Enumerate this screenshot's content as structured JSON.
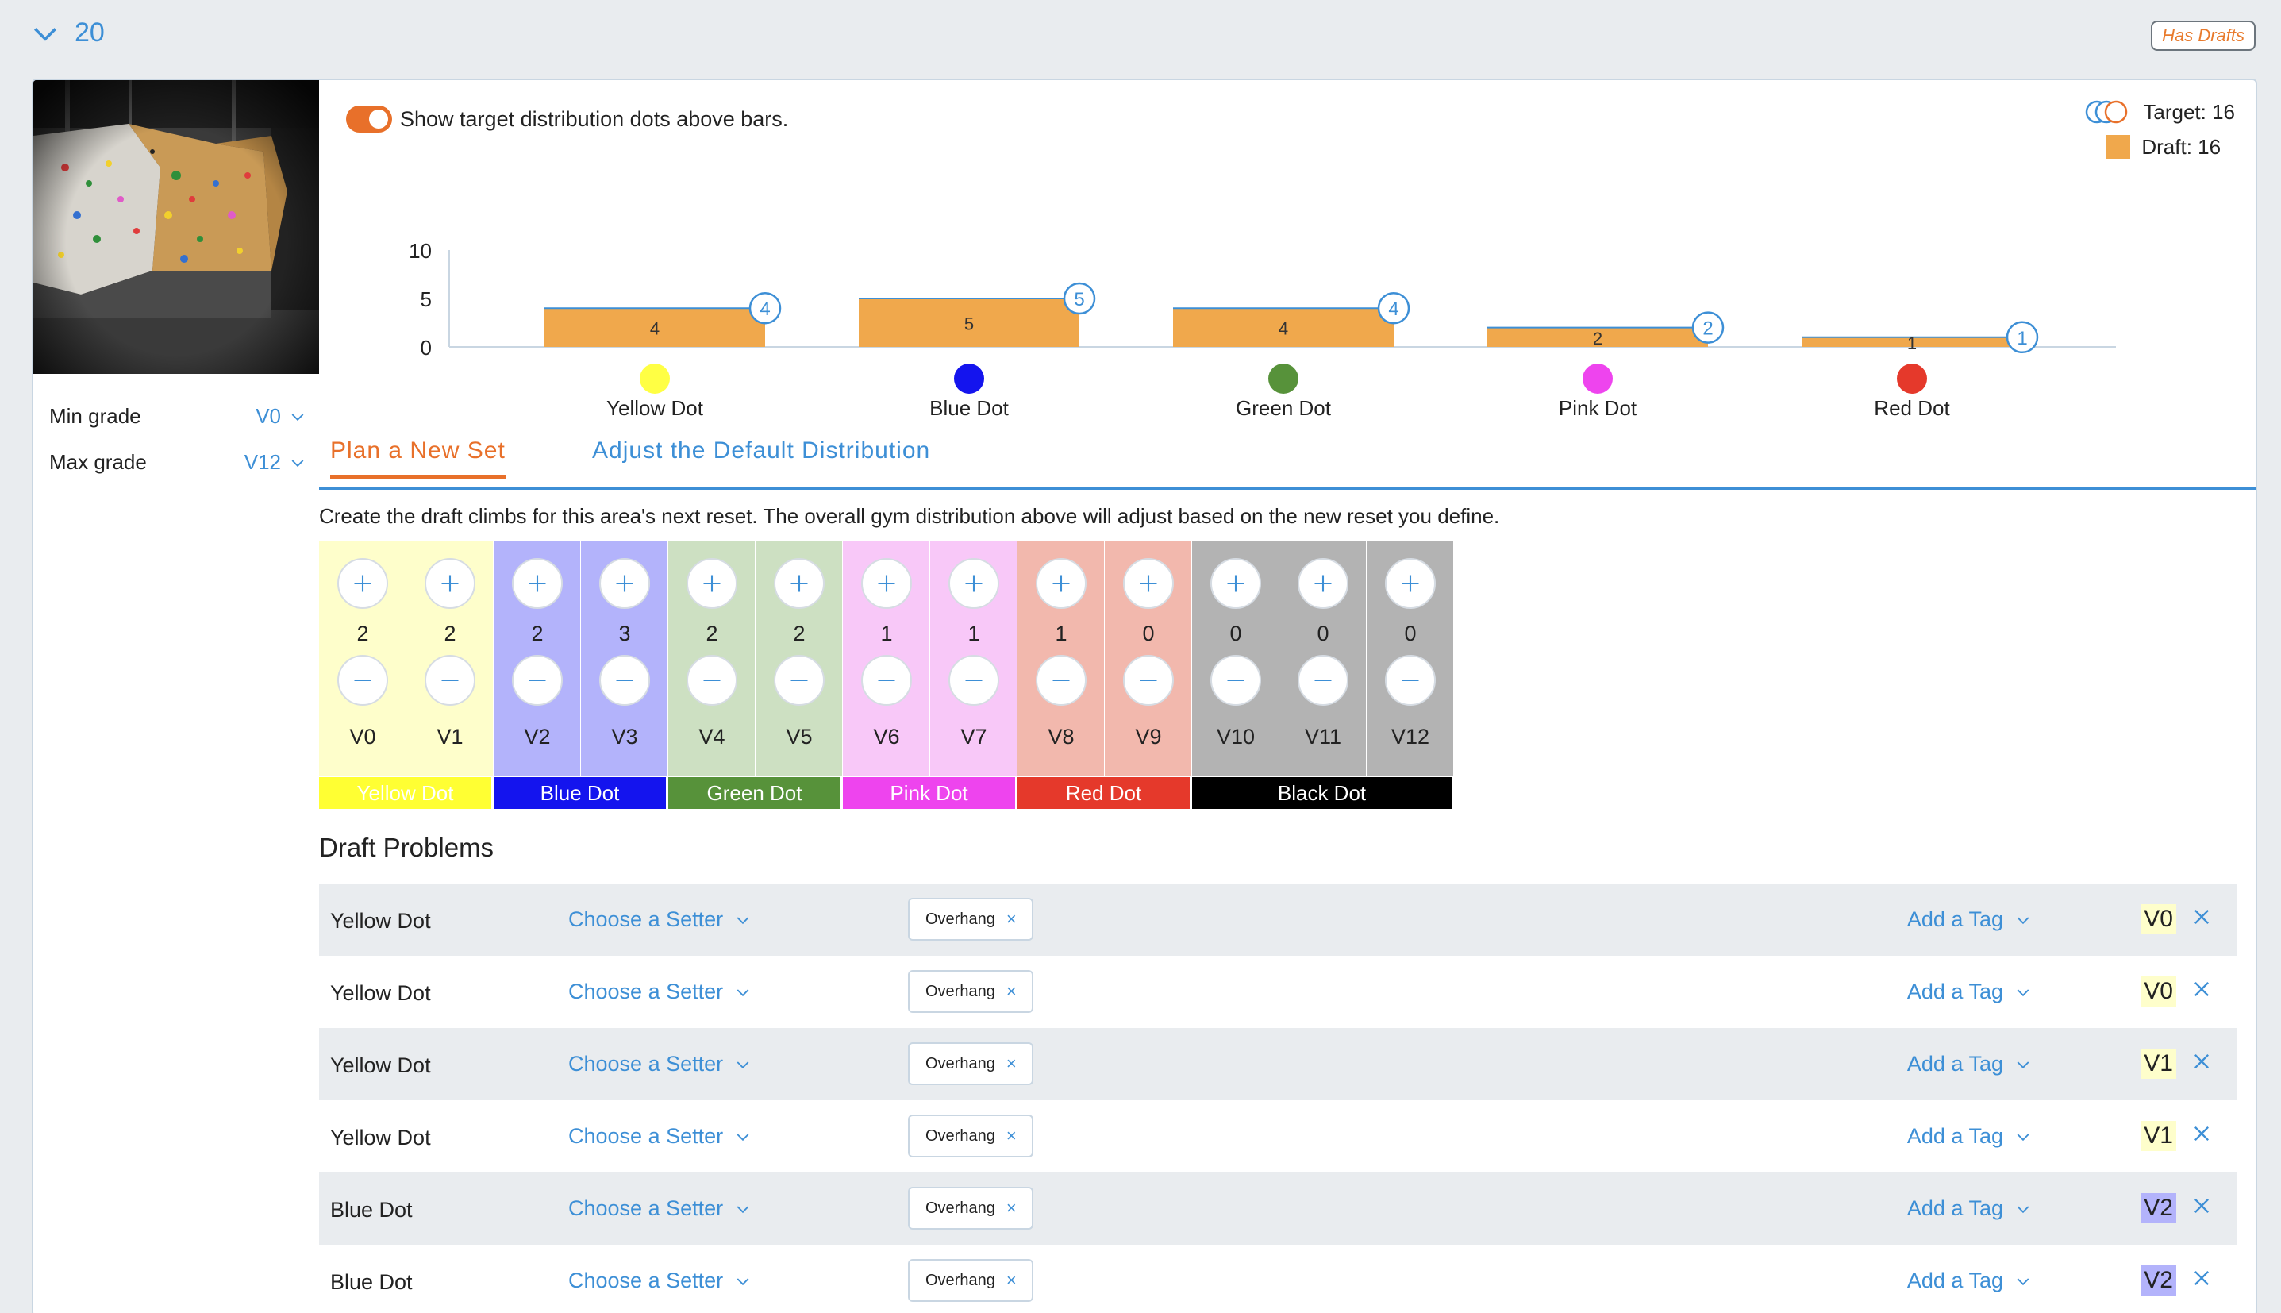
{
  "header": {
    "area_number": "20",
    "badge": "Has Drafts"
  },
  "filters": {
    "min_label": "Min grade",
    "min_value": "V0",
    "max_label": "Max grade",
    "max_value": "V12"
  },
  "chart_toggle": {
    "label": "Show target distribution dots above bars.",
    "on": true
  },
  "legend": {
    "target": "Target: 16",
    "draft": "Draft: 16"
  },
  "chart_data": {
    "type": "bar",
    "categories": [
      "Yellow Dot",
      "Blue Dot",
      "Green Dot",
      "Pink Dot",
      "Red Dot"
    ],
    "category_colors": [
      "#ffff44",
      "#1414ee",
      "#57923a",
      "#ee44ee",
      "#e5392b"
    ],
    "series": [
      {
        "name": "Draft",
        "values": [
          4,
          5,
          4,
          2,
          1
        ],
        "color": "#f0a84c"
      },
      {
        "name": "Target",
        "values": [
          4,
          5,
          4,
          2,
          1
        ],
        "color": "#3d8fd6"
      }
    ],
    "y_ticks": [
      "10",
      "5",
      "0"
    ],
    "ylim": [
      0,
      10
    ]
  },
  "tabs": [
    "Plan a New Set",
    "Adjust the Default Distribution"
  ],
  "description": "Create the draft climbs for this area's next reset. The overall gym distribution above will adjust based on the new reset you define.",
  "grades": [
    {
      "name": "V0",
      "count": "2",
      "bg": "#fefecb"
    },
    {
      "name": "V1",
      "count": "2",
      "bg": "#fefecb"
    },
    {
      "name": "V2",
      "count": "2",
      "bg": "#b3b3fb"
    },
    {
      "name": "V3",
      "count": "3",
      "bg": "#b3b3fb"
    },
    {
      "name": "V4",
      "count": "2",
      "bg": "#cde0c2"
    },
    {
      "name": "V5",
      "count": "2",
      "bg": "#cde0c2"
    },
    {
      "name": "V6",
      "count": "1",
      "bg": "#f8c8f8"
    },
    {
      "name": "V7",
      "count": "1",
      "bg": "#f8c8f8"
    },
    {
      "name": "V8",
      "count": "1",
      "bg": "#f2b8ad"
    },
    {
      "name": "V9",
      "count": "0",
      "bg": "#f2b8ad"
    },
    {
      "name": "V10",
      "count": "0",
      "bg": "#b3b3b3"
    },
    {
      "name": "V11",
      "count": "0",
      "bg": "#b3b3b3"
    },
    {
      "name": "V12",
      "count": "0",
      "bg": "#b3b3b3"
    }
  ],
  "color_groups": [
    {
      "label": "Yellow Dot",
      "bg": "#ffff33",
      "span": 2
    },
    {
      "label": "Blue Dot",
      "bg": "#1414ee",
      "span": 2
    },
    {
      "label": "Green Dot",
      "bg": "#57923a",
      "span": 2
    },
    {
      "label": "Pink Dot",
      "bg": "#ee44ee",
      "span": 2
    },
    {
      "label": "Red Dot",
      "bg": "#e5392b",
      "span": 2
    },
    {
      "label": "Black Dot",
      "bg": "#000000",
      "span": 3
    }
  ],
  "draft_title": "Draft Problems",
  "draft_rows": [
    {
      "climb": "Yellow Dot",
      "setter": "Choose a Setter",
      "tag": "Overhang",
      "add_tag": "Add a Tag",
      "grade": "V0",
      "badge_bg": "#fefecb"
    },
    {
      "climb": "Yellow Dot",
      "setter": "Choose a Setter",
      "tag": "Overhang",
      "add_tag": "Add a Tag",
      "grade": "V0",
      "badge_bg": "#fefecb"
    },
    {
      "climb": "Yellow Dot",
      "setter": "Choose a Setter",
      "tag": "Overhang",
      "add_tag": "Add a Tag",
      "grade": "V1",
      "badge_bg": "#fefecb"
    },
    {
      "climb": "Yellow Dot",
      "setter": "Choose a Setter",
      "tag": "Overhang",
      "add_tag": "Add a Tag",
      "grade": "V1",
      "badge_bg": "#fefecb"
    },
    {
      "climb": "Blue Dot",
      "setter": "Choose a Setter",
      "tag": "Overhang",
      "add_tag": "Add a Tag",
      "grade": "V2",
      "badge_bg": "#b3b3fb"
    },
    {
      "climb": "Blue Dot",
      "setter": "Choose a Setter",
      "tag": "Overhang",
      "add_tag": "Add a Tag",
      "grade": "V2",
      "badge_bg": "#b3b3fb"
    }
  ]
}
